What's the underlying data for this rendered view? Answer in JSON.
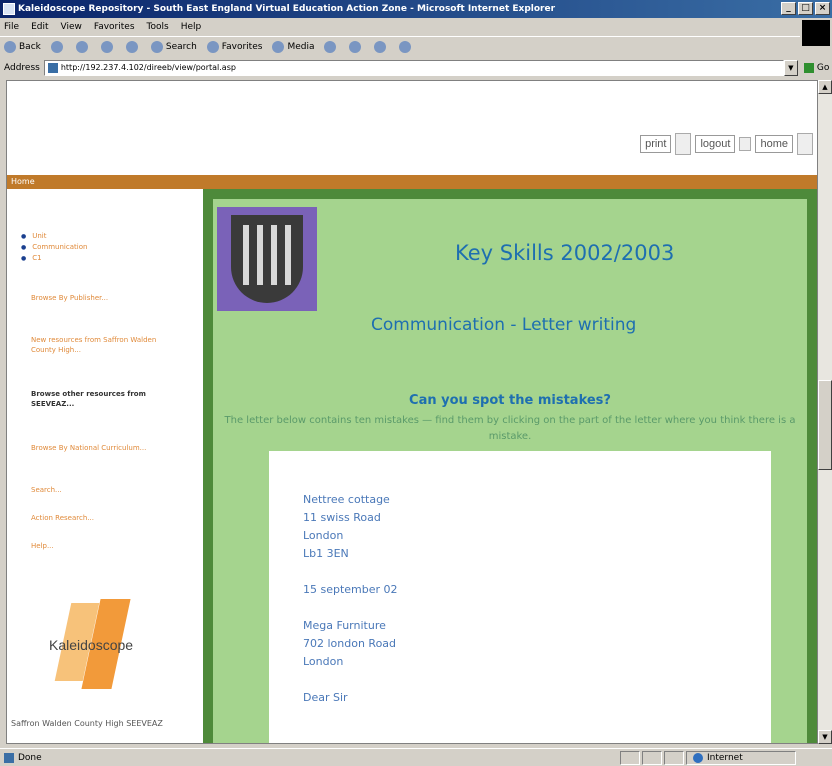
{
  "window": {
    "title": "Kaleidoscope Repository - South East England Virtual Education Action Zone - Microsoft Internet Explorer",
    "minimize": "_",
    "maximize": "□",
    "close": "×"
  },
  "menu": [
    "File",
    "Edit",
    "View",
    "Favorites",
    "Tools",
    "Help"
  ],
  "toolbar": {
    "back": "Back",
    "search": "Search",
    "favorites": "Favorites",
    "media": "Media"
  },
  "address": {
    "label": "Address",
    "url": "http://192.237.4.102/direeb/view/portal.asp",
    "go": "Go"
  },
  "header": {
    "print": "print",
    "logout": "logout",
    "home": "home",
    "nav_label": "Home"
  },
  "sidebar": {
    "bullets": [
      "Unit",
      "Communication",
      "C1"
    ],
    "links": [
      {
        "label": "Browse By Publisher...",
        "dark": false
      },
      {
        "label": "New resources from Saffron Walden County High...",
        "dark": false
      },
      {
        "label": "Browse other resources from SEEVEAZ...",
        "dark": true
      },
      {
        "label": "Browse By National Curriculum...",
        "dark": false
      },
      {
        "label": "Search...",
        "dark": false
      },
      {
        "label": "Action Research...",
        "dark": false
      },
      {
        "label": "Help...",
        "dark": false
      }
    ],
    "logo_text": "Kaleidoscope",
    "footer": "Saffron Walden County High SEEVEAZ"
  },
  "main": {
    "title": "Key Skills 2002/2003",
    "subtitle": "Communication - Letter writing",
    "question": "Can you spot the mistakes?",
    "instructions": "The letter below contains ten mistakes — find them by clicking on the part of the letter where you think there is a mistake.",
    "letter": {
      "address": [
        "Nettree cottage",
        "11 swiss Road",
        "London",
        "Lb1 3EN"
      ],
      "date": "15 september 02",
      "recipient": [
        "Mega Furniture",
        "702 london Road",
        "London"
      ],
      "salutation": "Dear Sir"
    }
  },
  "status": {
    "left": "Done",
    "zone": "Internet"
  }
}
